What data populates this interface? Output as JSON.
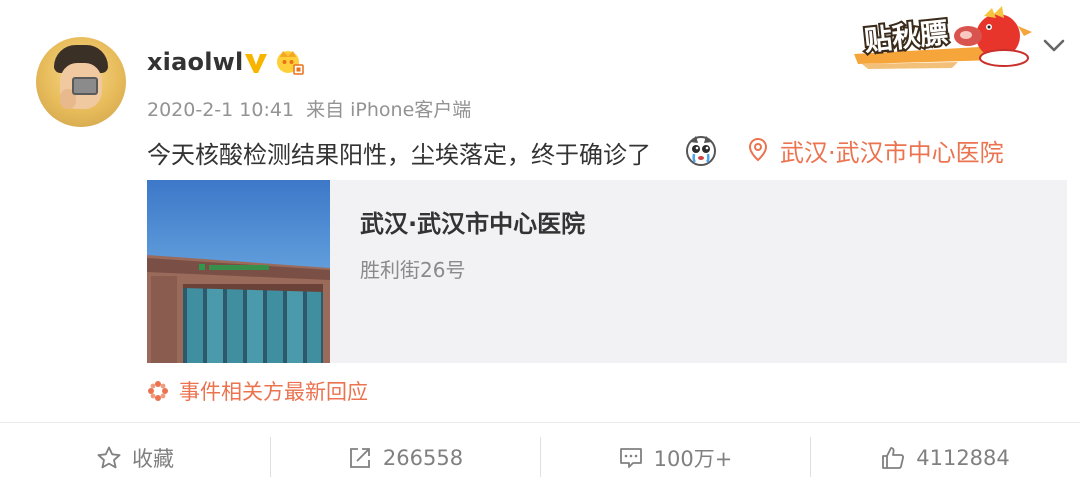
{
  "user": {
    "name": "xiaolwl",
    "verified_icon": "v-badge-icon",
    "vip_icon": "vip-crown-icon"
  },
  "post": {
    "date": "2020-2-1 10:41",
    "source": "来自 iPhone客户端",
    "text": "今天核酸检测结果阳性，尘埃落定，终于确诊了",
    "emoji": "tearful-face-emoji",
    "location": "武汉·武汉市中心医院"
  },
  "decoration": {
    "text": "贴秋膘"
  },
  "card": {
    "title": "武汉·武汉市中心医院",
    "subtitle": "胜利街26号"
  },
  "event_link": {
    "label": "事件相关方最新回应"
  },
  "actions": {
    "favorite": "收藏",
    "repost": "266558",
    "comment": "100万+",
    "like": "4112884"
  },
  "colors": {
    "accent": "#eb7350",
    "text": "#333333",
    "meta": "#939393",
    "card_bg": "#f2f2f5"
  }
}
